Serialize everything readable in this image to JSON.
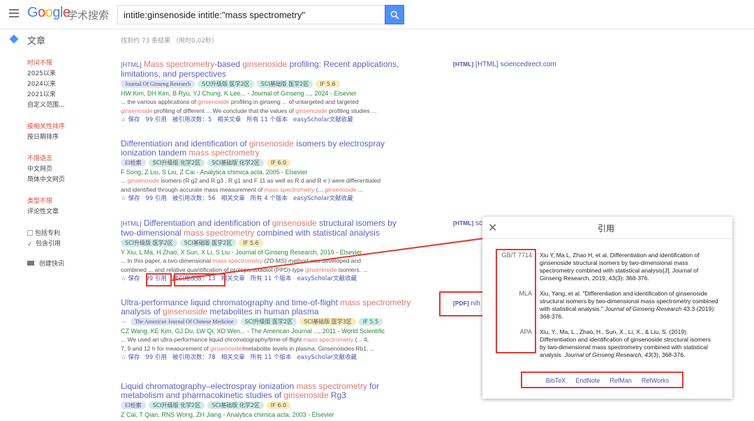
{
  "header": {
    "logo": "Google",
    "logo_sub": "学术搜索",
    "query": "intitle:ginsenoside intitle:\"mass spectrometry\""
  },
  "section_label": "文章",
  "stats": "找到约 73 条结果 （用时0.02秒）",
  "sidebar": {
    "time": [
      "时间不限",
      "2025以来",
      "2024以来",
      "2021以来",
      "自定义范围..."
    ],
    "sort": [
      "按相关性排序",
      "按日期排序"
    ],
    "lang": [
      "不限语言",
      "中文网页",
      "简体中文网页"
    ],
    "type": [
      "类型不限",
      "评论性文章"
    ],
    "options": [
      "包括专利",
      "包含引用"
    ],
    "alert": "创建快讯"
  },
  "results": [
    {
      "tag": "[HTML]",
      "title_parts": [
        "Mass spectrometry",
        "-based ",
        "ginsenoside",
        " profiling: Recent applications, limitations, and perspectives"
      ],
      "badges": [
        "Journal Of Ginseng Research",
        "SCI升级版 医学2区",
        "SCI基础版 医学2区",
        "IF 5.6"
      ],
      "authors": "HW Kim, DH Kim, B Ryu, YJ Chung, K Lee... - Journal of Ginseng ..., 2024 - Elsevier",
      "snippet1": [
        "... the various applications of ",
        "ginsenoside",
        " profiling in ginseng ... of untargeted and targeted"
      ],
      "snippet2": [
        "ginsenoside",
        " profiling of different ... We conclude that the values of ",
        "ginsenoside",
        " profiling studies ..."
      ],
      "acts": [
        "☆ 保存",
        "99 引用",
        "被引用次数：5",
        "相关文章",
        "所有 11 个版本",
        "easyScholar文献收藏"
      ],
      "side": "[HTML] sciencedirect.com"
    },
    {
      "tag": "",
      "title_parts": [
        "Differentiation and identification of ",
        "ginsenoside",
        " isomers by electrospray ionization tandem ",
        "mass spectrometry"
      ],
      "badges": [
        "EI检索",
        "SCI升级版 化学2区",
        "SCI基础版 化学2区",
        "IF 6.0"
      ],
      "authors": "F Song, Z Liu, S Liu, Z Cai - Analytica chimica acta, 2005 - Elsevier",
      "snippet1": [
        "... ",
        "ginsenoside",
        " isomers (R g2 and R g3 , R g1 and F 11 as well as R d and R e ) were differentiated"
      ],
      "snippet2": [
        "and identified through accurate mass measurement of ",
        "mass spectrometry",
        " (... ",
        "ginsenoside",
        " ..."
      ],
      "acts": [
        "☆ 保存",
        "99 引用",
        "被引用次数：56",
        "相关文章",
        "所有 4 个版本",
        "easyScholar文献收藏"
      ],
      "side": ""
    },
    {
      "tag": "[HTML]",
      "title_parts": [
        "Differentiation and identification of ",
        "ginsenoside",
        " structural isomers by two-dimensional ",
        "mass spectrometry",
        " combined with statistical analysis"
      ],
      "badges": [
        "SCI升级版 医学2区",
        "SCI基础版 医学2区",
        "IF 5.6"
      ],
      "authors": "Y Xiu, L Ma, H Zhao, X Sun, X Li, S Liu - Journal of Ginseng Research, 2019 - Elsevier",
      "snippet1": [
        "... In this paper, a two-dimensional ",
        "mass spectrometry",
        " (2D-MS) method was developed and"
      ],
      "snippet2": [
        "combined ... and relative quantification of protopanaxadiol (PPD)-type ",
        "ginsenoside",
        " isomers. ..."
      ],
      "acts": [
        "☆ 保存",
        "99 引用",
        "被引用次数：13",
        "相关文章",
        "所有 11 个版本",
        "easyScholar文献收藏"
      ],
      "side": "[HTML] sc"
    },
    {
      "tag": "",
      "title_parts": [
        "Ultra-performance liquid chromatography and time-of-flight ",
        "mass spectrometry",
        " analysis of ",
        "ginsenoside",
        " metabolites in human plasma"
      ],
      "badges": [
        "The American Journal Of Chinese Medicine",
        "SCI升级版 医学2区",
        "SCI基础版 医学3区",
        "IF 5.5"
      ],
      "authors": "CZ Wang, KE Kim, GJ Du, LW Qi, XD Wen... - The American Journal ..., 2011 - World Scientific",
      "snippet1": [
        "... We used an ultra-performance liquid chromatography/time-of-flight ",
        "mass spectrometry",
        " (... 4,"
      ],
      "snippet2": [
        "7, 9 and 12 h for measurement of ",
        "ginsenoside",
        "/metabolite levels in plasma. Ginsenosides Rb1, ..."
      ],
      "acts": [
        "☆ 保存",
        "99 引用",
        "被引用次数：78",
        "相关文章",
        "所有 11 个版本",
        "easyScholar文献收藏"
      ],
      "side": "[PDF] nih"
    },
    {
      "tag": "",
      "title_parts": [
        "Liquid chromatography–electrospray ionization ",
        "mass spectrometry",
        " for metabolism and pharmacokinetic studies of ",
        "ginsenoside",
        " Rg3"
      ],
      "badges": [
        "EI检索",
        "SCI升级版 化学2区",
        "SCI基础版 化学2区",
        "IF 6.0"
      ],
      "authors": "Z Cai, T Qian, RNS Wong, ZH Jiang - Analytica chimica acta, 2003 - Elsevier",
      "snippet1": [],
      "snippet2": [],
      "acts": [],
      "side": ""
    }
  ],
  "popup": {
    "close": "✕",
    "title": "引用",
    "citations": [
      {
        "label": "GB/T 7714",
        "text": "Xiu Y, Ma L, Zhao H, et al. Differentiation and identification of ginsenoside structural isomers by two-dimensional mass spectrometry combined with statistical analysis[J]. Journal of Ginseng Research, 2019, 43(3): 368-376."
      },
      {
        "label": "MLA",
        "text_a": "Xiu, Yang, et al. \"Differentiation and identification of ginsenoside structural isomers by two-dimensional mass spectrometry combined with statistical analysis.\" ",
        "journal": "Journal of Ginseng Research",
        "text_b": " 43.3 (2019): 368-376."
      },
      {
        "label": "APA",
        "text_a": "Xiu, Y., Ma, L., Zhao, H., Sun, X., Li, X., & Liu, S. (2019). Differentiation and identification of ginsenoside structural isomers by two-dimensional mass spectrometry combined with statistical analysis. ",
        "journal": "Journal of Ginseng Research",
        "text_b": ", ",
        "volume": "43",
        "text_c": "(3), 368-376."
      }
    ],
    "links": [
      "BibTeX",
      "EndNote",
      "RefMan",
      "RefWorks"
    ]
  },
  "colors": {
    "accent": "#4d90fe",
    "highlight": "#e8372c"
  }
}
